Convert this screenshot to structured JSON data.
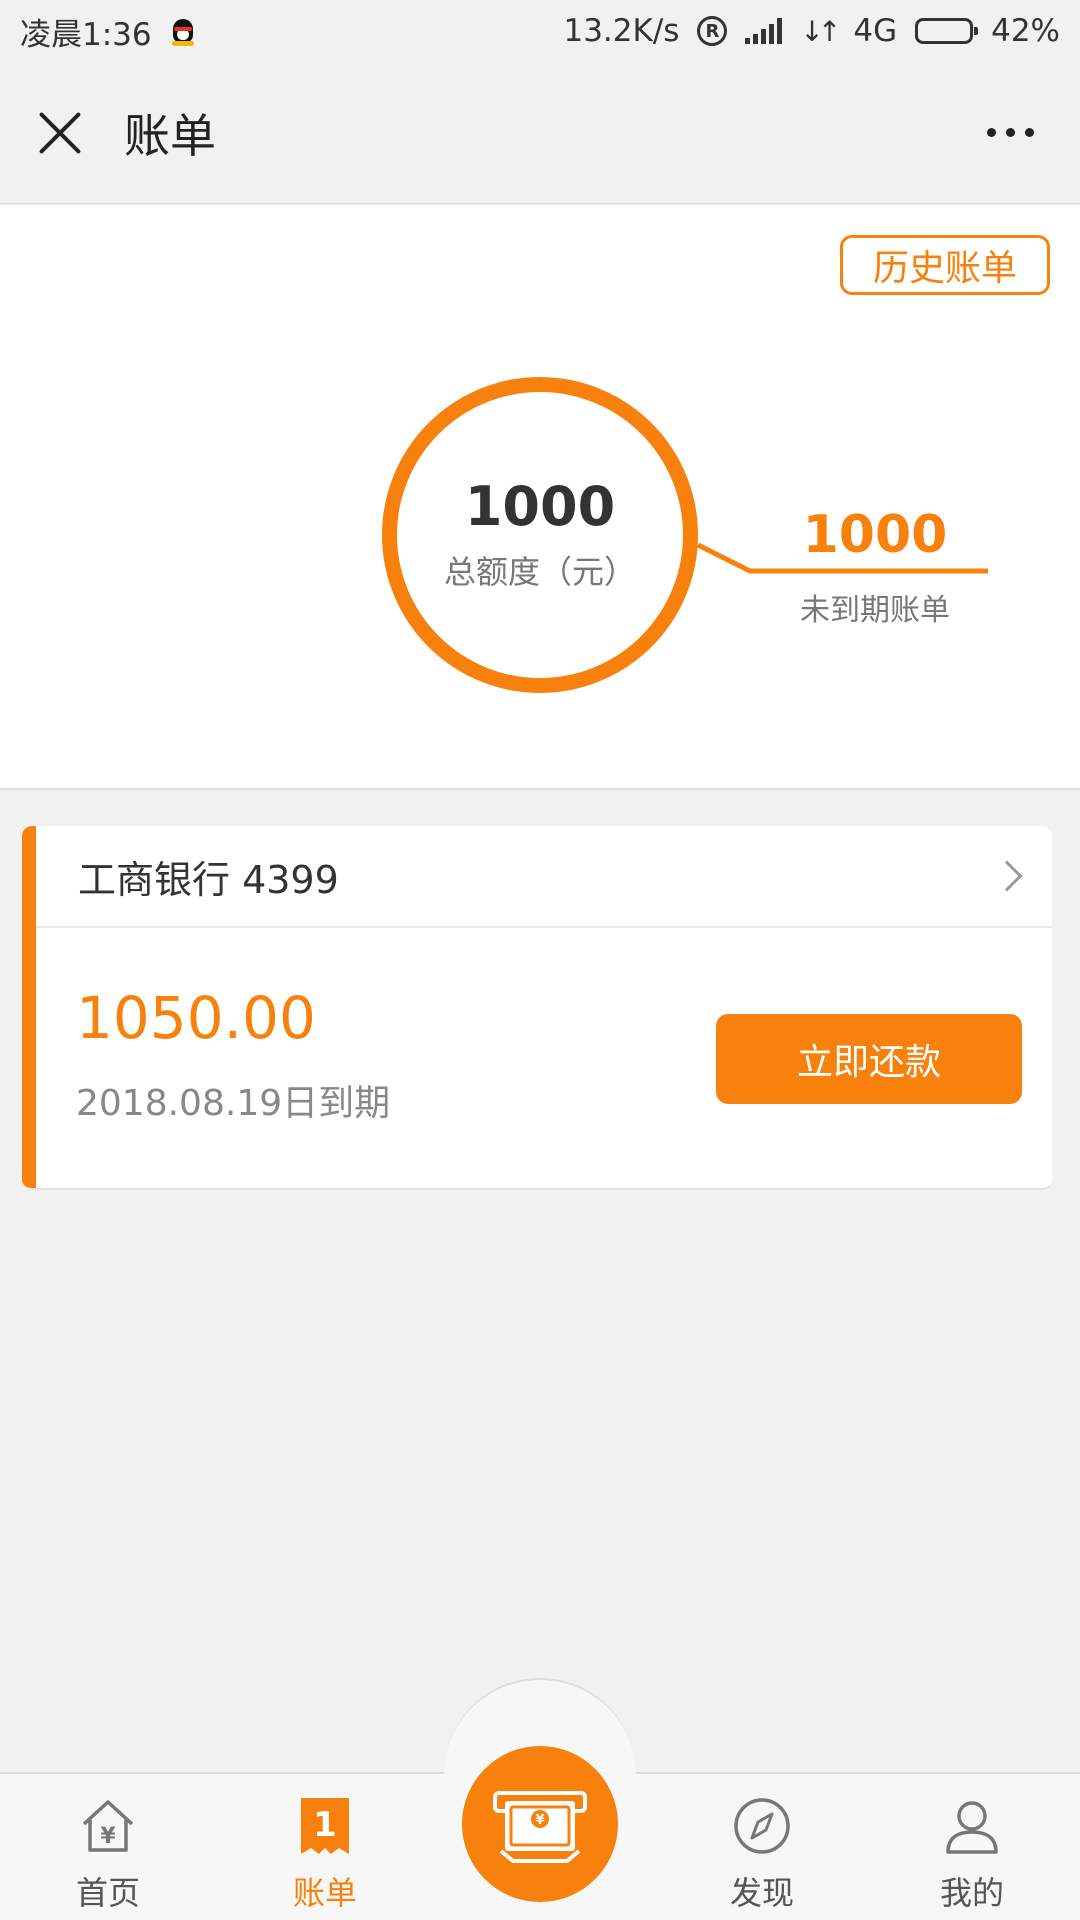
{
  "status_bar": {
    "time": "凌晨1:36",
    "network_speed": "13.2K/s",
    "registered_mark": "R",
    "network_type": "4G",
    "battery": "42%",
    "battery_level": 0.42
  },
  "header": {
    "title": "账单"
  },
  "summary": {
    "history_label": "历史账单",
    "total_amount": "1000",
    "total_label": "总额度（元）",
    "unpaid_amount": "1000",
    "unpaid_label": "未到期账单"
  },
  "bill": {
    "bank": "工商银行 4399",
    "amount": "1050.00",
    "due_date": "2018.08.19日到期",
    "repay_label": "立即还款"
  },
  "bottom_nav": {
    "items": [
      {
        "label": "首页",
        "icon": "home-yuan-icon"
      },
      {
        "label": "账单",
        "icon": "bill-icon"
      },
      {
        "label": "发现",
        "icon": "compass-icon"
      },
      {
        "label": "我的",
        "icon": "user-icon"
      }
    ],
    "center_icon": "cash-machine-icon",
    "active_index": 1
  },
  "colors": {
    "accent": "#f7810c",
    "background": "#f1f1f1",
    "card": "#ffffff"
  }
}
